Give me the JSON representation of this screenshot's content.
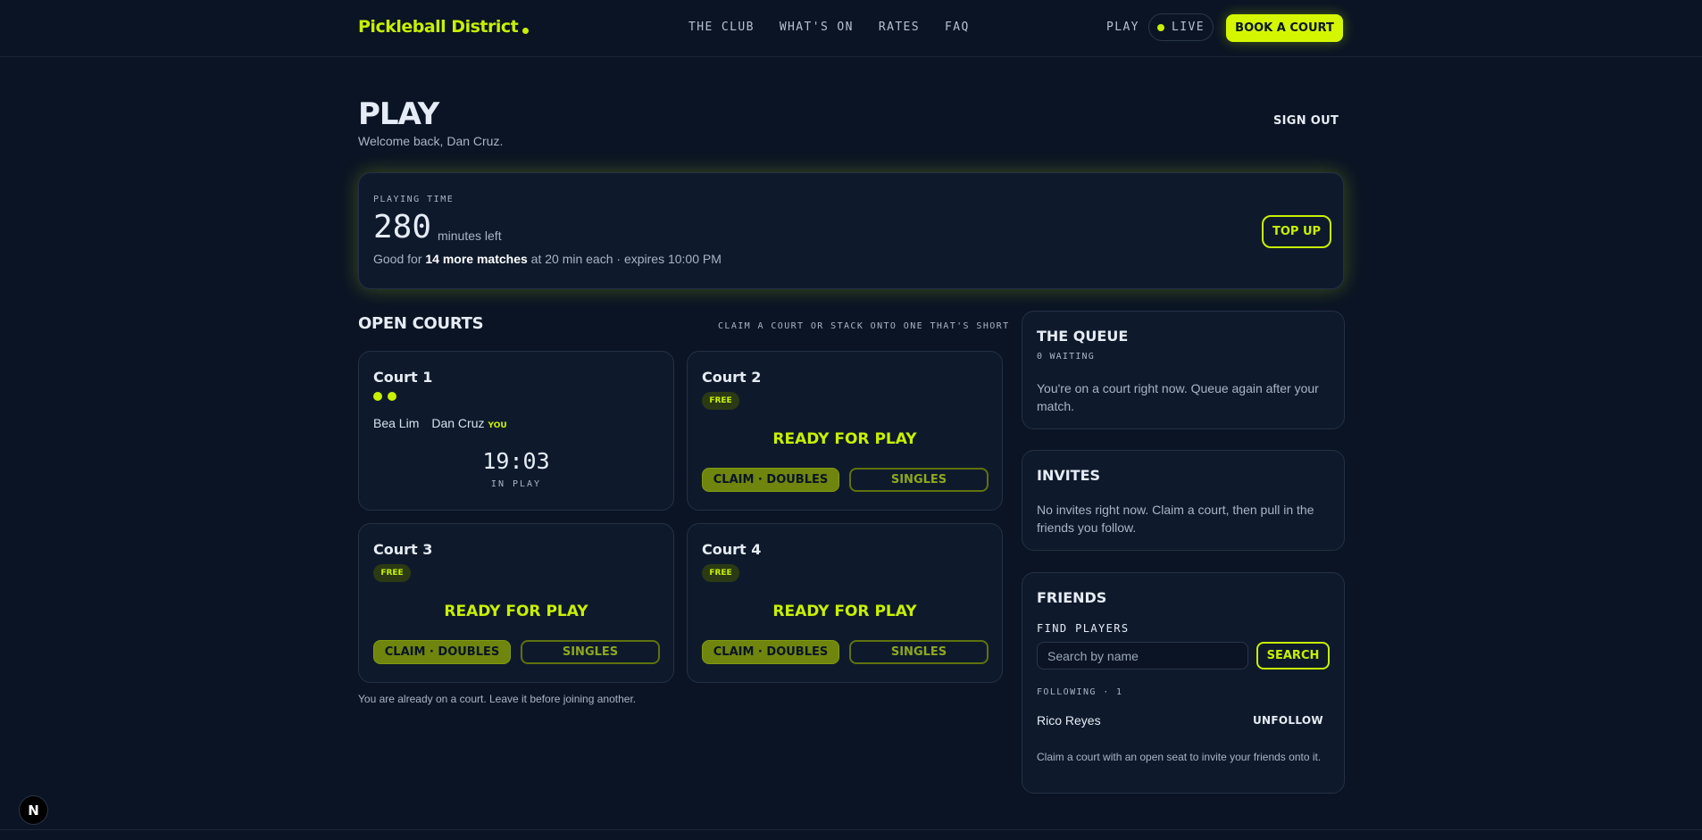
{
  "header": {
    "logo": "Pickleball District",
    "nav": [
      "THE CLUB",
      "WHAT'S ON",
      "RATES",
      "FAQ"
    ],
    "play_link": "PLAY",
    "live_label": "LIVE",
    "book_button": "BOOK A COURT"
  },
  "page": {
    "title": "PLAY",
    "welcome": "Welcome back, Dan Cruz.",
    "sign_out": "SIGN OUT"
  },
  "playing_time": {
    "label": "PLAYING TIME",
    "minutes": "280",
    "unit": "minutes left",
    "sub_prefix": "Good for",
    "sub_bold": "14 more matches",
    "sub_suffix": "at 20 min each · expires 10:00 PM",
    "top_up_button": "TOP UP"
  },
  "open_courts": {
    "title": "OPEN COURTS",
    "hint": "CLAIM A COURT OR STACK ONTO ONE THAT'S SHORT",
    "courts": [
      {
        "name": "Court 1",
        "filled_seats": 2,
        "players": [
          "Bea Lim",
          "Dan Cruz"
        ],
        "you_tag": "YOU",
        "timer": "19:03",
        "state": "IN PLAY"
      },
      {
        "name": "Court 2",
        "badge": "FREE",
        "status": "READY FOR PLAY",
        "claim_button": "CLAIM · DOUBLES",
        "singles_button": "SINGLES"
      },
      {
        "name": "Court 3",
        "badge": "FREE",
        "status": "READY FOR PLAY",
        "claim_button": "CLAIM · DOUBLES",
        "singles_button": "SINGLES"
      },
      {
        "name": "Court 4",
        "badge": "FREE",
        "status": "READY FOR PLAY",
        "claim_button": "CLAIM · DOUBLES",
        "singles_button": "SINGLES"
      }
    ],
    "already_note": "You are already on a court. Leave it before joining another."
  },
  "queue": {
    "title": "THE QUEUE",
    "waiting": "0 WAITING",
    "text": "You're on a court right now. Queue again after your match."
  },
  "invites": {
    "title": "INVITES",
    "text": "No invites right now. Claim a court, then pull in the friends you follow."
  },
  "friends": {
    "title": "FRIENDS",
    "find_label": "FIND PLAYERS",
    "search_placeholder": "Search by name",
    "search_button": "SEARCH",
    "following_label": "FOLLOWING · 1",
    "following": [
      {
        "name": "Rico Reyes",
        "action": "UNFOLLOW"
      }
    ],
    "note": "Claim a court with an open seat to invite your friends onto it."
  },
  "dev_badge": "N",
  "colors": {
    "background": "#0a1424",
    "card": "#0e1a2c",
    "accent": "#c8f000"
  }
}
